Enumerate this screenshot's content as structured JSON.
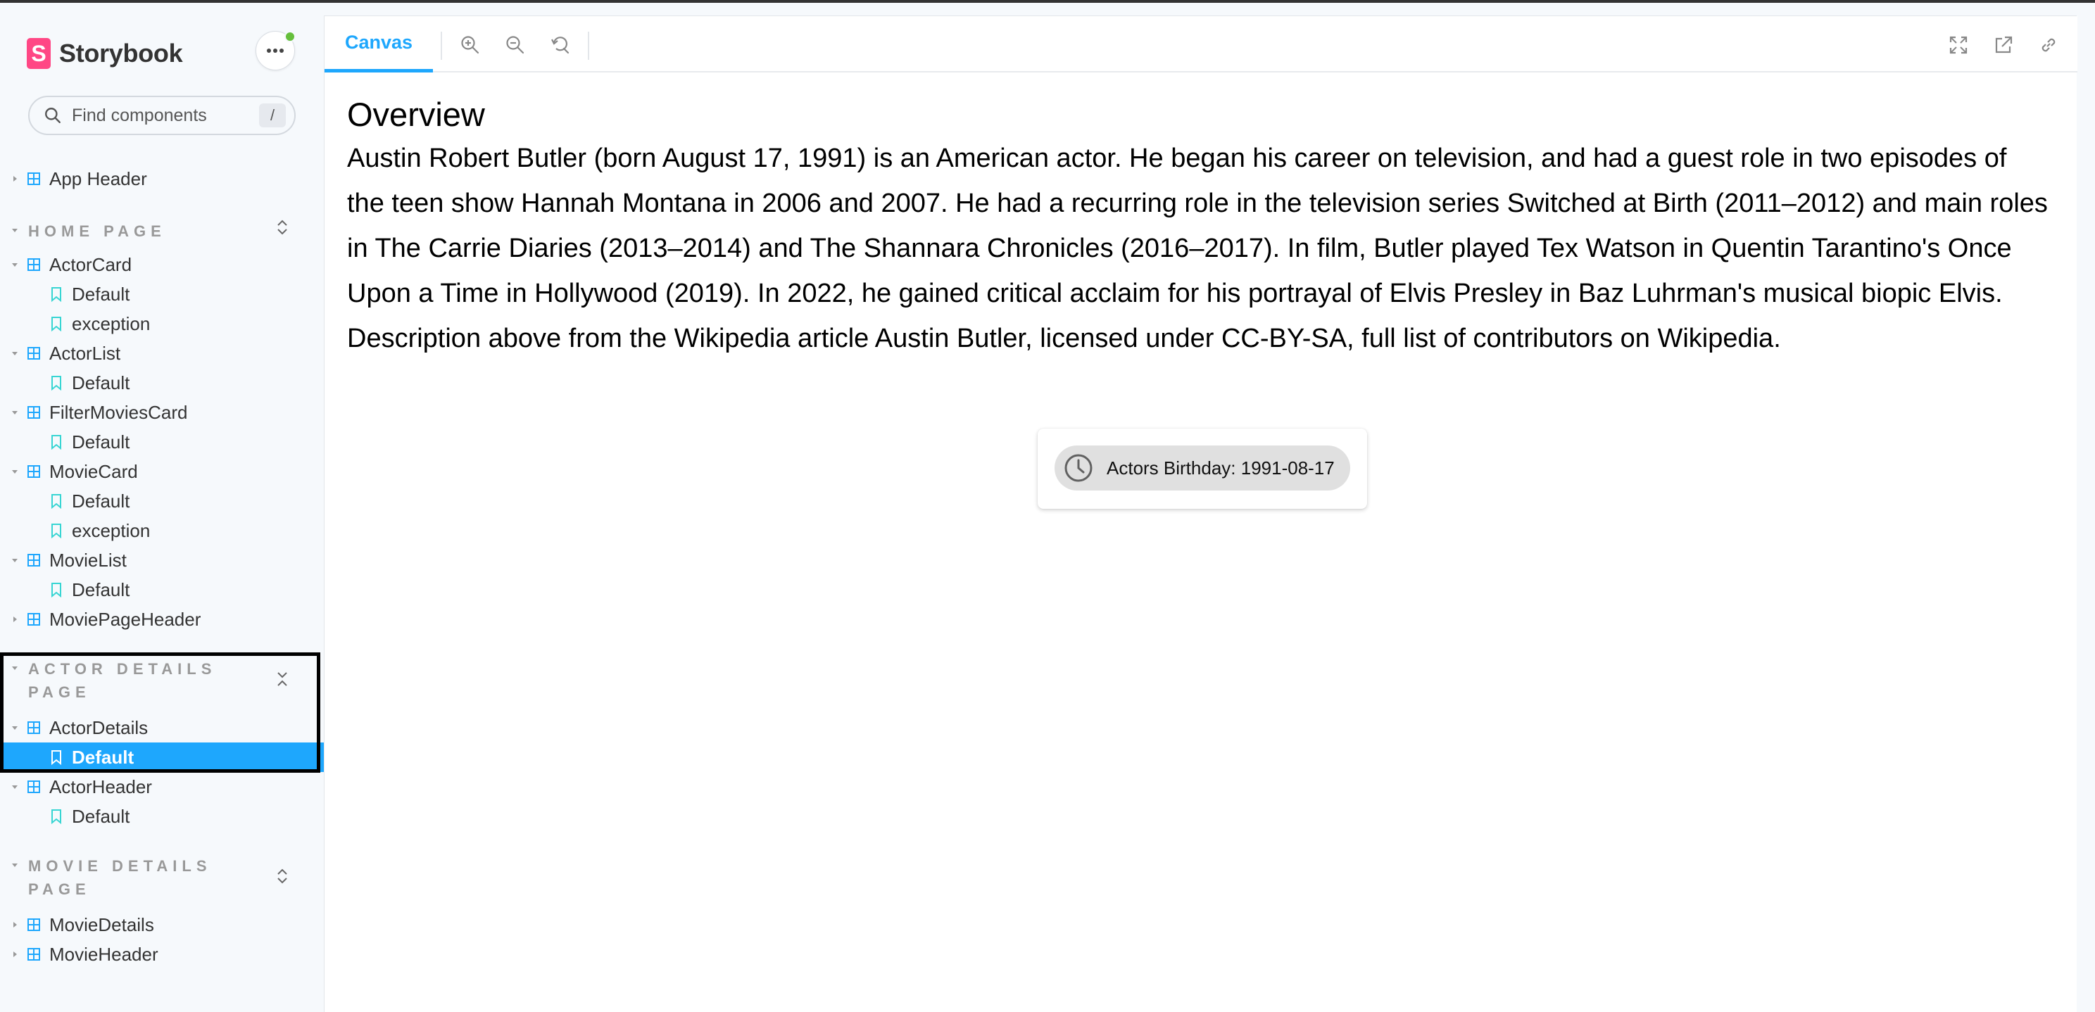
{
  "brand": {
    "name": "Storybook",
    "logo_letter": "S"
  },
  "search": {
    "placeholder": "Find components",
    "shortcut": "/"
  },
  "sidebar": {
    "top_item": {
      "label": "App Header"
    },
    "groups": [
      {
        "title": "Home Page",
        "components": [
          {
            "label": "ActorCard",
            "stories": [
              "Default",
              "exception"
            ]
          },
          {
            "label": "ActorList",
            "stories": [
              "Default"
            ]
          },
          {
            "label": "FilterMoviesCard",
            "stories": [
              "Default"
            ]
          },
          {
            "label": "MovieCard",
            "stories": [
              "Default",
              "exception"
            ]
          },
          {
            "label": "MovieList",
            "stories": [
              "Default"
            ]
          },
          {
            "label": "MoviePageHeader",
            "stories": []
          }
        ]
      },
      {
        "title": "Actor Details Page",
        "components": [
          {
            "label": "ActorDetails",
            "stories": [
              "Default"
            ]
          },
          {
            "label": "ActorHeader",
            "stories": [
              "Default"
            ]
          }
        ]
      },
      {
        "title": "Movie Details Page",
        "components": [
          {
            "label": "MovieDetails",
            "stories": []
          },
          {
            "label": "MovieHeader",
            "stories": []
          }
        ]
      }
    ],
    "selected": "ActorDetails / Default"
  },
  "toolbar": {
    "tab_label": "Canvas",
    "icons": [
      "zoom-in-icon",
      "zoom-out-icon",
      "reset-zoom-icon",
      "fullscreen-icon",
      "open-new-tab-icon",
      "copy-link-icon"
    ]
  },
  "canvas": {
    "title": "Overview",
    "description": "Austin Robert Butler (born August 17, 1991) is an American actor. He began his career on television, and had a guest role in two episodes of the teen show Hannah Montana in 2006 and 2007. He had a recurring role in the television series Switched at Birth (2011–2012) and main roles in The Carrie Diaries (2013–2014) and The Shannara Chronicles (2016–2017). In film, Butler played Tex Watson in Quentin Tarantino's Once Upon a Time in Hollywood (2019). In 2022, he gained critical acclaim for his portrayal of Elvis Presley in Baz Luhrman's musical biopic Elvis. Description above from the Wikipedia article Austin Butler, licensed under CC-BY-SA, full list of contributors on Wikipedia.",
    "chip_label": "Actors Birthday: 1991-08-17"
  },
  "colors": {
    "accent": "#1ea7fd",
    "brand": "#ff4785",
    "story_icon": "#37d5d3",
    "component_icon": "#1ea7fd",
    "status": "#66bf3c"
  }
}
